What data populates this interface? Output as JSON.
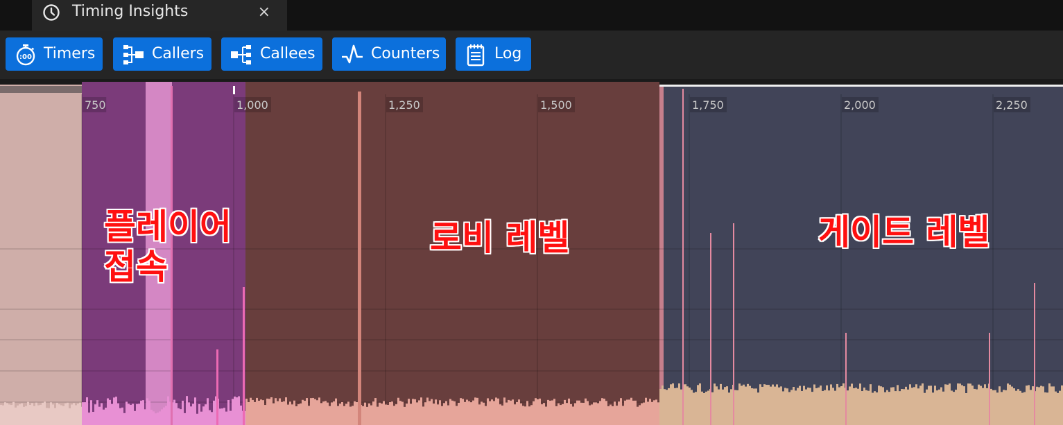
{
  "window": {
    "tab_title": "Timing Insights",
    "close_glyph": "×",
    "tab_icon": "clock-icon",
    "close_icon": "close-icon"
  },
  "toolbar": {
    "buttons": [
      {
        "label": "Timers",
        "icon": "stopwatch-icon"
      },
      {
        "label": "Callers",
        "icon": "callers-tree-icon"
      },
      {
        "label": "Callees",
        "icon": "callees-tree-icon"
      },
      {
        "label": "Counters",
        "icon": "counters-pulse-icon"
      },
      {
        "label": "Log",
        "icon": "log-notepad-icon"
      }
    ],
    "button_color": "#0c70dc"
  },
  "timeline": {
    "tick_labels": [
      "750",
      "1,000",
      "1,250",
      "1,500",
      "1,750",
      "2,000",
      "2,250"
    ],
    "ticks": [
      750,
      1000,
      1250,
      1500,
      1750,
      2000,
      2250
    ],
    "regions": [
      {
        "name": "player-connect",
        "start": 650,
        "end": 1020,
        "color": "#7b3b7a"
      },
      {
        "name": "lobby-level",
        "start": 1020,
        "end": 1705,
        "color": "#683e3d"
      },
      {
        "name": "gate-level",
        "start": 1705,
        "end": 2345,
        "color": "#414458"
      }
    ],
    "annotations": {
      "player_connect": "플레이어\n접속",
      "lobby_level": "로비 레벨",
      "gate_level": "게이트 레벨"
    },
    "annotation_color": "#ff1010"
  }
}
